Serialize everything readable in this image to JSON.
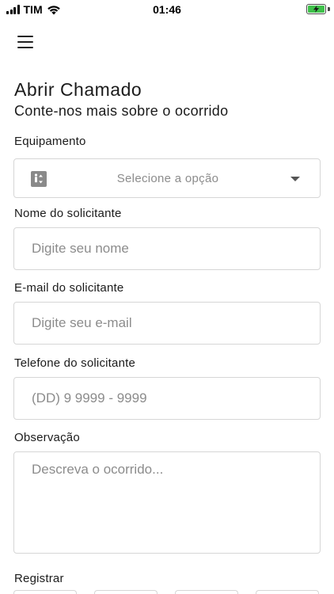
{
  "status_bar": {
    "carrier": "TIM",
    "time": "01:46"
  },
  "header": {
    "title": "Abrir Chamado",
    "subtitle": "Conte-nos mais sobre o ocorrido"
  },
  "form": {
    "equipment": {
      "label": "Equipamento",
      "placeholder": "Selecione a opção"
    },
    "requester_name": {
      "label": "Nome do solicitante",
      "placeholder": "Digite seu nome"
    },
    "requester_email": {
      "label": "E-mail do solicitante",
      "placeholder": "Digite seu e-mail"
    },
    "requester_phone": {
      "label": "Telefone do solicitante",
      "placeholder": "(DD) 9 9999 - 9999"
    },
    "observation": {
      "label": "Observação",
      "placeholder": "Descreva o ocorrido..."
    },
    "register": {
      "label": "Registrar"
    }
  },
  "icons": {
    "menu": "hamburger-menu-icon",
    "equipment": "elevator-icon",
    "dropdown": "caret-down-icon",
    "wifi": "wifi-icon",
    "battery": "battery-charging-icon"
  },
  "colors": {
    "battery_fill": "#3fc14b",
    "border": "#d6d6d6",
    "placeholder": "#8c8c8c"
  }
}
